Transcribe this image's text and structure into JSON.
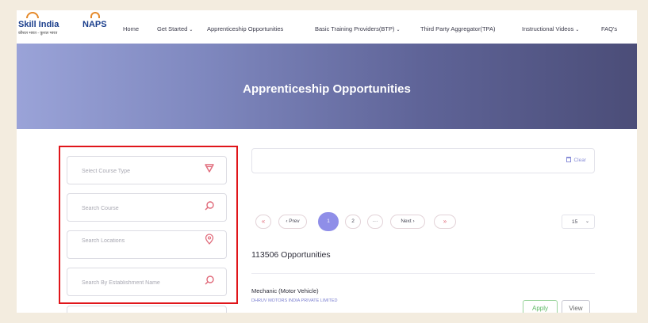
{
  "nav": {
    "logo_skill": "Skill India",
    "logo_skill_sub": "कौशल भारत - कुशल भारत",
    "logo_naps": "NAPS",
    "items": [
      {
        "label": "Home"
      },
      {
        "label": "Get Started"
      },
      {
        "label": "Apprenticeship Opportunities"
      },
      {
        "label": "Basic Training Providers(BTP)"
      },
      {
        "label": "Third Party Aggregator(TPA)"
      },
      {
        "label": "Instructional Videos"
      },
      {
        "label": "FAQ's"
      }
    ]
  },
  "hero": {
    "title": "Apprenticeship Opportunities"
  },
  "filters": {
    "course_type_placeholder": "Select Course Type",
    "course_placeholder": "Search Course",
    "locations_placeholder": "Search Locations",
    "establishment_placeholder": "Search By Establishment Name"
  },
  "clear_label": "Clear",
  "pagination": {
    "first": "«",
    "prev": "‹ Prev",
    "page1": "1",
    "page2": "2",
    "ellipsis": "···",
    "next": "Next ›",
    "last": "»",
    "per_page": "15"
  },
  "results": {
    "count": "113506 Opportunities",
    "job_title": "Mechanic (Motor Vehicle)",
    "company": "DHRUV MOTORS INDIA PRIVATE LIMITED",
    "apply": "Apply",
    "view": "View"
  },
  "colors": {
    "accent": "#8f8ee8",
    "hero_start": "#9aa3d8",
    "hero_end": "#4b4d78",
    "highlight": "#e0151a",
    "icon_red": "#e06a7a"
  },
  "icons": {
    "filter": "filter-icon",
    "search": "search-icon",
    "location": "location-pin-icon",
    "clear": "trash-icon"
  }
}
